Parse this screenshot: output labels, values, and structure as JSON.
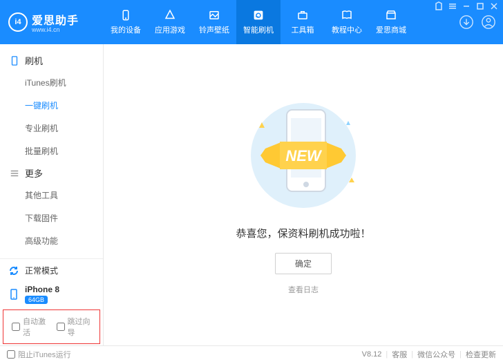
{
  "header": {
    "logo_text": "爱思助手",
    "logo_badge": "i4",
    "logo_sub": "www.i4.cn",
    "nav": [
      {
        "label": "我的设备"
      },
      {
        "label": "应用游戏"
      },
      {
        "label": "铃声壁纸"
      },
      {
        "label": "智能刷机"
      },
      {
        "label": "工具箱"
      },
      {
        "label": "教程中心"
      },
      {
        "label": "爱思商城"
      }
    ]
  },
  "sidebar": {
    "group1": {
      "title": "刷机"
    },
    "items1": [
      {
        "label": "iTunes刷机"
      },
      {
        "label": "一键刷机"
      },
      {
        "label": "专业刷机"
      },
      {
        "label": "批量刷机"
      }
    ],
    "group2": {
      "title": "更多"
    },
    "items2": [
      {
        "label": "其他工具"
      },
      {
        "label": "下载固件"
      },
      {
        "label": "高级功能"
      }
    ],
    "mode": "正常模式",
    "device": "iPhone 8",
    "storage": "64GB",
    "checkboxes": [
      {
        "label": "自动激活"
      },
      {
        "label": "跳过向导"
      }
    ]
  },
  "main": {
    "message": "恭喜您，保资料刷机成功啦！",
    "ok": "确定",
    "log": "查看日志",
    "ribbon": "NEW"
  },
  "footer": {
    "block_itunes": "阻止iTunes运行",
    "version": "V8.12",
    "support": "客服",
    "wechat": "微信公众号",
    "update": "检查更新"
  }
}
